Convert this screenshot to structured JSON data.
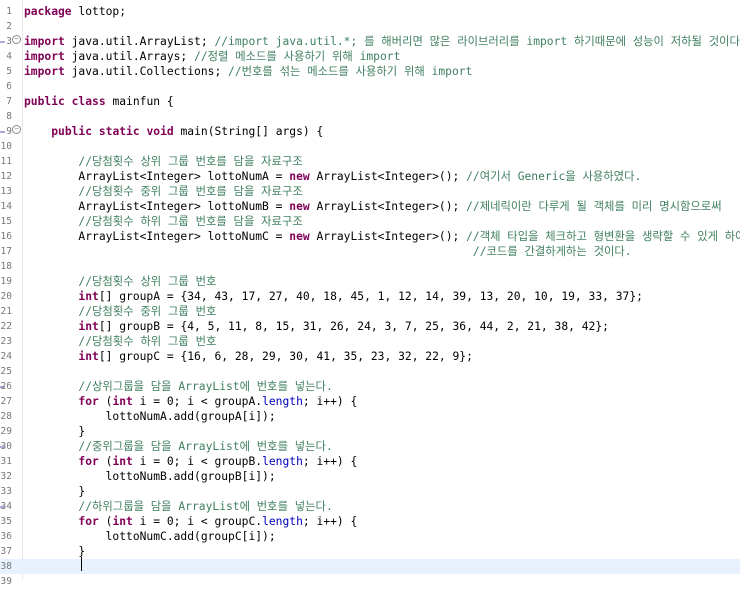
{
  "editor": {
    "lines": [
      {
        "num": "1",
        "fold": "",
        "tokens": [
          {
            "t": "kw",
            "x": "package"
          },
          {
            "t": "pl",
            "x": " lottop;"
          }
        ]
      },
      {
        "num": "2",
        "fold": "",
        "tokens": []
      },
      {
        "num": "3",
        "fold": "−",
        "tokens": [
          {
            "t": "kw",
            "x": "import"
          },
          {
            "t": "pl",
            "x": " java.util.ArrayList; "
          },
          {
            "t": "cm",
            "x": "//import java.util.*; 를 해버리면 많은 라이브러리를 import 하기때문에 성능이 저하될 것이다."
          }
        ]
      },
      {
        "num": "4",
        "fold": "",
        "tokens": [
          {
            "t": "kw",
            "x": "import"
          },
          {
            "t": "pl",
            "x": " java.util.Arrays; "
          },
          {
            "t": "cm",
            "x": "//정렬 메소드를 사용하기 위해 import"
          }
        ]
      },
      {
        "num": "5",
        "fold": "",
        "tokens": [
          {
            "t": "kw",
            "x": "import"
          },
          {
            "t": "pl",
            "x": " java.util.Collections; "
          },
          {
            "t": "cm",
            "x": "//번호를 섞는 메소드를 사용하기 위해 import"
          }
        ]
      },
      {
        "num": "6",
        "fold": "",
        "tokens": []
      },
      {
        "num": "7",
        "fold": "",
        "tokens": [
          {
            "t": "kw",
            "x": "public"
          },
          {
            "t": "pl",
            "x": " "
          },
          {
            "t": "kw",
            "x": "class"
          },
          {
            "t": "pl",
            "x": " mainfun {"
          }
        ]
      },
      {
        "num": "8",
        "fold": "",
        "tokens": []
      },
      {
        "num": "9",
        "fold": "−",
        "tokens": [
          {
            "t": "pl",
            "x": "    "
          },
          {
            "t": "kw",
            "x": "public"
          },
          {
            "t": "pl",
            "x": " "
          },
          {
            "t": "kw",
            "x": "static"
          },
          {
            "t": "pl",
            "x": " "
          },
          {
            "t": "kw",
            "x": "void"
          },
          {
            "t": "pl",
            "x": " main(String[] args) {"
          }
        ]
      },
      {
        "num": "10",
        "fold": "",
        "tokens": []
      },
      {
        "num": "11",
        "fold": "",
        "tokens": [
          {
            "t": "pl",
            "x": "        "
          },
          {
            "t": "cm",
            "x": "//당첨횟수 상위 그룹 번호를 담을 자료구조"
          }
        ]
      },
      {
        "num": "12",
        "fold": "",
        "tokens": [
          {
            "t": "pl",
            "x": "        ArrayList<Integer> lottoNumA = "
          },
          {
            "t": "kw",
            "x": "new"
          },
          {
            "t": "pl",
            "x": " ArrayList<Integer>(); "
          },
          {
            "t": "cm",
            "x": "//여기서 Generic을 사용하였다."
          }
        ]
      },
      {
        "num": "13",
        "fold": "",
        "tokens": [
          {
            "t": "pl",
            "x": "        "
          },
          {
            "t": "cm",
            "x": "//당첨횟수 중위 그룹 번호를 담을 자료구조"
          }
        ]
      },
      {
        "num": "14",
        "fold": "",
        "tokens": [
          {
            "t": "pl",
            "x": "        ArrayList<Integer> lottoNumB = "
          },
          {
            "t": "kw",
            "x": "new"
          },
          {
            "t": "pl",
            "x": " ArrayList<Integer>(); "
          },
          {
            "t": "cm",
            "x": "//제네릭이란 다루게 될 객체를 미리 명시함으로써"
          }
        ]
      },
      {
        "num": "15",
        "fold": "",
        "tokens": [
          {
            "t": "pl",
            "x": "        "
          },
          {
            "t": "cm",
            "x": "//당첨횟수 하위 그룹 번호를 담을 자료구조"
          }
        ]
      },
      {
        "num": "16",
        "fold": "",
        "tokens": [
          {
            "t": "pl",
            "x": "        ArrayList<Integer> lottoNumC = "
          },
          {
            "t": "kw",
            "x": "new"
          },
          {
            "t": "pl",
            "x": " ArrayList<Integer>(); "
          },
          {
            "t": "cm",
            "x": "//객체 타입을 체크하고 형변환을 생략할 수 있게 하여"
          }
        ]
      },
      {
        "num": "17",
        "fold": "",
        "tokens": [
          {
            "t": "pl",
            "x": "                                                                  "
          },
          {
            "t": "cm",
            "x": "//코드를 간결하게하는 것이다."
          }
        ]
      },
      {
        "num": "18",
        "fold": "",
        "tokens": []
      },
      {
        "num": "19",
        "fold": "",
        "tokens": [
          {
            "t": "pl",
            "x": "        "
          },
          {
            "t": "cm",
            "x": "//당첨횟수 상위 그룹 번호"
          }
        ]
      },
      {
        "num": "20",
        "fold": "",
        "tokens": [
          {
            "t": "pl",
            "x": "        "
          },
          {
            "t": "kw",
            "x": "int"
          },
          {
            "t": "pl",
            "x": "[] groupA = {34, 43, 17, 27, 40, 18, 45, 1, 12, 14, 39, 13, 20, 10, 19, 33, 37};"
          }
        ]
      },
      {
        "num": "21",
        "fold": "",
        "tokens": [
          {
            "t": "pl",
            "x": "        "
          },
          {
            "t": "cm",
            "x": "//당첨횟수 중위 그룹 번호"
          }
        ]
      },
      {
        "num": "22",
        "fold": "",
        "tokens": [
          {
            "t": "pl",
            "x": "        "
          },
          {
            "t": "kw",
            "x": "int"
          },
          {
            "t": "pl",
            "x": "[] groupB = {4, 5, 11, 8, 15, 31, 26, 24, 3, 7, 25, 36, 44, 2, 21, 38, 42};"
          }
        ]
      },
      {
        "num": "23",
        "fold": "",
        "tokens": [
          {
            "t": "pl",
            "x": "        "
          },
          {
            "t": "cm",
            "x": "//당첨횟수 하위 그룹 번호"
          }
        ]
      },
      {
        "num": "24",
        "fold": "",
        "tokens": [
          {
            "t": "pl",
            "x": "        "
          },
          {
            "t": "kw",
            "x": "int"
          },
          {
            "t": "pl",
            "x": "[] groupC = {16, 6, 28, 29, 30, 41, 35, 23, 32, 22, 9};"
          }
        ]
      },
      {
        "num": "25",
        "fold": "",
        "tokens": []
      },
      {
        "num": "26",
        "fold": "",
        "tokens": [
          {
            "t": "pl",
            "x": "        "
          },
          {
            "t": "cm",
            "x": "//상위그룹을 담을 ArrayList에 번호를 넣는다."
          }
        ]
      },
      {
        "num": "27",
        "fold": "",
        "tokens": [
          {
            "t": "pl",
            "x": "        "
          },
          {
            "t": "kw",
            "x": "for"
          },
          {
            "t": "pl",
            "x": " ("
          },
          {
            "t": "kw",
            "x": "int"
          },
          {
            "t": "pl",
            "x": " i = 0; i < groupA."
          },
          {
            "t": "fd",
            "x": "length"
          },
          {
            "t": "pl",
            "x": "; i++) {"
          }
        ]
      },
      {
        "num": "28",
        "fold": "",
        "tokens": [
          {
            "t": "pl",
            "x": "            lottoNumA.add(groupA[i]);"
          }
        ]
      },
      {
        "num": "29",
        "fold": "",
        "tokens": [
          {
            "t": "pl",
            "x": "        }"
          }
        ]
      },
      {
        "num": "30",
        "fold": "",
        "tokens": [
          {
            "t": "pl",
            "x": "        "
          },
          {
            "t": "cm",
            "x": "//중위그룹을 담을 ArrayList에 번호를 넣는다."
          }
        ]
      },
      {
        "num": "31",
        "fold": "",
        "tokens": [
          {
            "t": "pl",
            "x": "        "
          },
          {
            "t": "kw",
            "x": "for"
          },
          {
            "t": "pl",
            "x": " ("
          },
          {
            "t": "kw",
            "x": "int"
          },
          {
            "t": "pl",
            "x": " i = 0; i < groupB."
          },
          {
            "t": "fd",
            "x": "length"
          },
          {
            "t": "pl",
            "x": "; i++) {"
          }
        ]
      },
      {
        "num": "32",
        "fold": "",
        "tokens": [
          {
            "t": "pl",
            "x": "            lottoNumB.add(groupB[i]);"
          }
        ]
      },
      {
        "num": "33",
        "fold": "",
        "tokens": [
          {
            "t": "pl",
            "x": "        }"
          }
        ]
      },
      {
        "num": "34",
        "fold": "",
        "tokens": [
          {
            "t": "pl",
            "x": "        "
          },
          {
            "t": "cm",
            "x": "//하위그룹을 담을 ArrayList에 번호를 넣는다."
          }
        ]
      },
      {
        "num": "35",
        "fold": "",
        "tokens": [
          {
            "t": "pl",
            "x": "        "
          },
          {
            "t": "kw",
            "x": "for"
          },
          {
            "t": "pl",
            "x": " ("
          },
          {
            "t": "kw",
            "x": "int"
          },
          {
            "t": "pl",
            "x": " i = 0; i < groupC."
          },
          {
            "t": "fd",
            "x": "length"
          },
          {
            "t": "pl",
            "x": "; i++) {"
          }
        ]
      },
      {
        "num": "36",
        "fold": "",
        "tokens": [
          {
            "t": "pl",
            "x": "            lottoNumC.add(groupC[i]);"
          }
        ]
      },
      {
        "num": "37",
        "fold": "",
        "tokens": [
          {
            "t": "pl",
            "x": "        }"
          }
        ]
      },
      {
        "num": "38",
        "fold": "",
        "tokens": []
      },
      {
        "num": "39",
        "fold": "",
        "tokens": []
      }
    ],
    "current_line": "38",
    "marked_lines": [
      "3",
      "9",
      "26",
      "30",
      "34"
    ]
  },
  "colors": {
    "keyword": "#7f0055",
    "comment": "#3f7f5f",
    "field": "#0000c0",
    "plain": "#000000",
    "current_line_bg": "#e8f2fe"
  }
}
